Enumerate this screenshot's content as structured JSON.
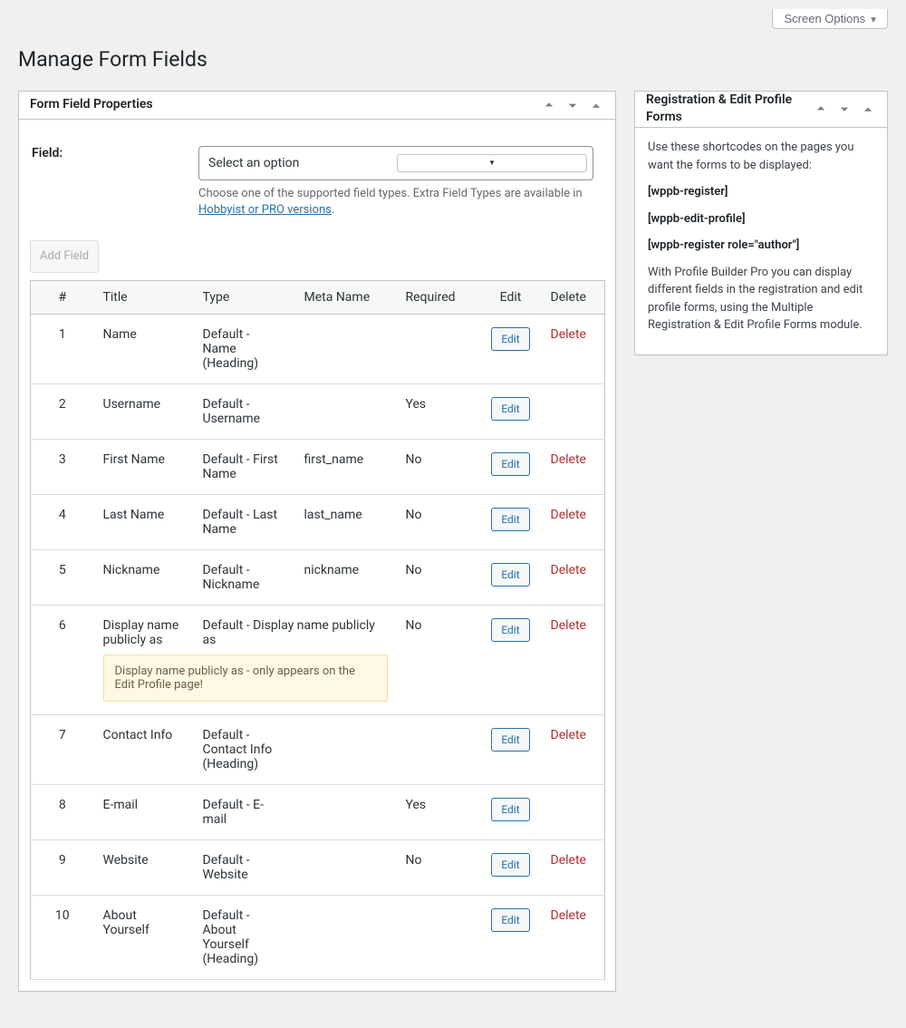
{
  "screen_options_label": "Screen Options",
  "page_title": "Manage Form Fields",
  "main_panel": {
    "title": "Form Field Properties",
    "field_label": "Field:",
    "select_placeholder": "Select an option",
    "help_prefix": "Choose one of the supported field types. Extra Field Types are available in ",
    "help_link": "Hobbyist or PRO versions",
    "help_suffix": ".",
    "add_field_label": "Add Field"
  },
  "table": {
    "headers": {
      "num": "#",
      "title": "Title",
      "type": "Type",
      "meta": "Meta Name",
      "required": "Required",
      "edit": "Edit",
      "delete": "Delete"
    },
    "edit_label": "Edit",
    "delete_label": "Delete",
    "rows": [
      {
        "num": "1",
        "title": "Name",
        "type": "Default - Name (Heading)",
        "meta": "",
        "required": "",
        "delete": true,
        "notice": ""
      },
      {
        "num": "2",
        "title": "Username",
        "type": "Default - Username",
        "meta": "",
        "required": "Yes",
        "delete": false,
        "notice": ""
      },
      {
        "num": "3",
        "title": "First Name",
        "type": "Default - First Name",
        "meta": "first_name",
        "required": "No",
        "delete": true,
        "notice": ""
      },
      {
        "num": "4",
        "title": "Last Name",
        "type": "Default - Last Name",
        "meta": "last_name",
        "required": "No",
        "delete": true,
        "notice": ""
      },
      {
        "num": "5",
        "title": "Nickname",
        "type": "Default - Nickname",
        "meta": "nickname",
        "required": "No",
        "delete": true,
        "notice": ""
      },
      {
        "num": "6",
        "title": "Display name publicly as",
        "type": "Default - Display name publicly as",
        "meta": "",
        "required": "No",
        "delete": true,
        "notice": "Display name publicly as - only appears on the Edit Profile page!"
      },
      {
        "num": "7",
        "title": "Contact Info",
        "type": "Default - Contact Info (Heading)",
        "meta": "",
        "required": "",
        "delete": true,
        "notice": ""
      },
      {
        "num": "8",
        "title": "E-mail",
        "type": "Default - E-mail",
        "meta": "",
        "required": "Yes",
        "delete": false,
        "notice": ""
      },
      {
        "num": "9",
        "title": "Website",
        "type": "Default - Website",
        "meta": "",
        "required": "No",
        "delete": true,
        "notice": ""
      },
      {
        "num": "10",
        "title": "About Yourself",
        "type": "Default - About Yourself (Heading)",
        "meta": "",
        "required": "",
        "delete": true,
        "notice": ""
      }
    ]
  },
  "side_panel": {
    "title": "Registration & Edit Profile Forms",
    "intro": "Use these shortcodes on the pages you want the forms to be displayed:",
    "shortcodes": [
      "[wppb-register]",
      "[wppb-edit-profile]",
      "[wppb-register role=\"author\"]"
    ],
    "desc": "With Profile Builder Pro you can display different fields in the registration and edit profile forms, using the Multiple Registration & Edit Profile Forms module."
  }
}
